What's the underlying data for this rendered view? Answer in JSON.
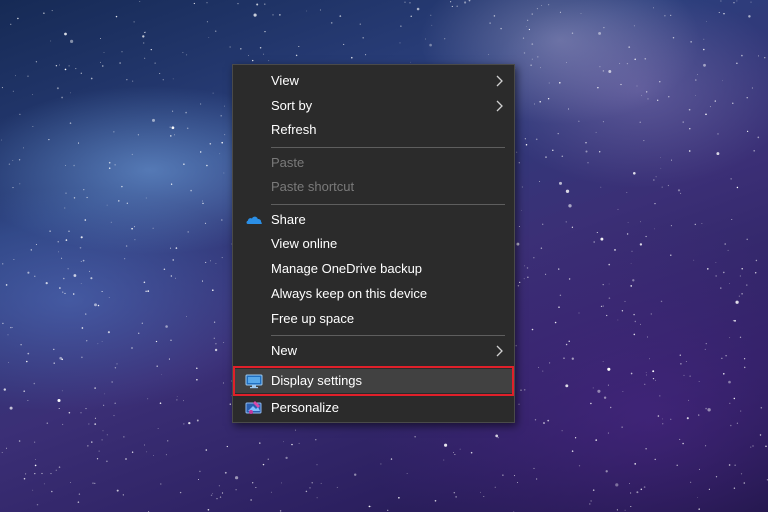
{
  "menu": {
    "items": [
      {
        "label": "View",
        "enabled": true,
        "submenu": true
      },
      {
        "label": "Sort by",
        "enabled": true,
        "submenu": true
      },
      {
        "label": "Refresh",
        "enabled": true
      },
      {
        "label": "Paste",
        "enabled": false
      },
      {
        "label": "Paste shortcut",
        "enabled": false
      },
      {
        "label": "Share",
        "enabled": true,
        "icon": "onedrive-cloud-icon"
      },
      {
        "label": "View online",
        "enabled": true
      },
      {
        "label": "Manage OneDrive backup",
        "enabled": true
      },
      {
        "label": "Always keep on this device",
        "enabled": true
      },
      {
        "label": "Free up space",
        "enabled": true
      },
      {
        "label": "New",
        "enabled": true,
        "submenu": true
      },
      {
        "label": "Display settings",
        "enabled": true,
        "icon": "display-settings-icon",
        "highlighted": true
      },
      {
        "label": "Personalize",
        "enabled": true,
        "icon": "personalize-icon"
      }
    ]
  },
  "colors": {
    "menu_background": "#2b2b2b",
    "highlight_outline": "#e0202a",
    "disabled_text": "#7a7a7a",
    "onedrive_blue": "#2b8fe6"
  }
}
